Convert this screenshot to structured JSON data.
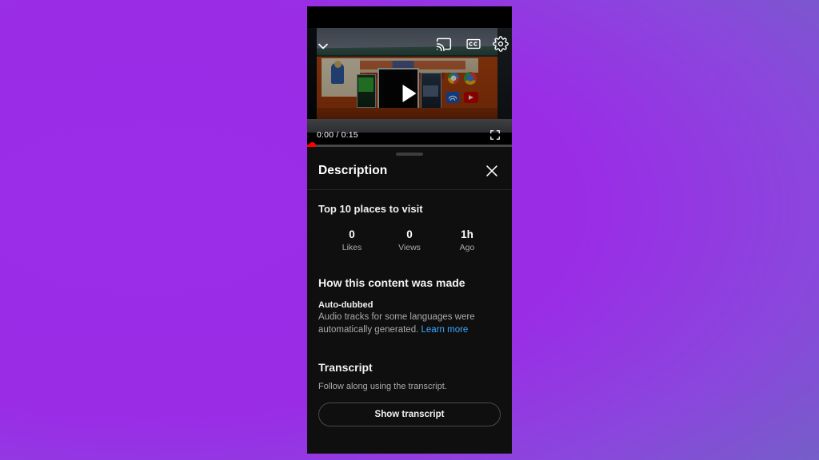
{
  "background": {
    "gradient_from": "#9b2ce8",
    "gradient_to": "#6271bd"
  },
  "player": {
    "minimize_icon": "chevron-down-icon",
    "cast_icon": "cast-icon",
    "captions_icon": "closed-captions-icon",
    "settings_icon": "gear-icon",
    "play_icon": "play-icon",
    "fullscreen_icon": "fullscreen-icon",
    "time_display": "0:00 / 0:15",
    "current_time": "0:00",
    "duration": "0:15",
    "progress_percent": 1,
    "progress_color": "#ff0000",
    "thumbnail_alt": "Storefront with orange walls, teal awning and Google, Chrome, Wi-Fi and YouTube logo stickers"
  },
  "sheet": {
    "drag_handle": "drag-handle",
    "title": "Description",
    "close_icon": "close-icon",
    "video_title": "Top 10 places to visit",
    "stats": [
      {
        "value": "0",
        "label": "Likes"
      },
      {
        "value": "0",
        "label": "Views"
      },
      {
        "value": "1h",
        "label": "Ago"
      }
    ],
    "content_made": {
      "heading": "How this content was made",
      "subtitle": "Auto-dubbed",
      "body": "Audio tracks for some languages were automatically generated.",
      "link_label": "Learn more",
      "link_color": "#3ea6ff"
    },
    "transcript": {
      "heading": "Transcript",
      "description": "Follow along using the transcript.",
      "button_label": "Show transcript"
    }
  }
}
